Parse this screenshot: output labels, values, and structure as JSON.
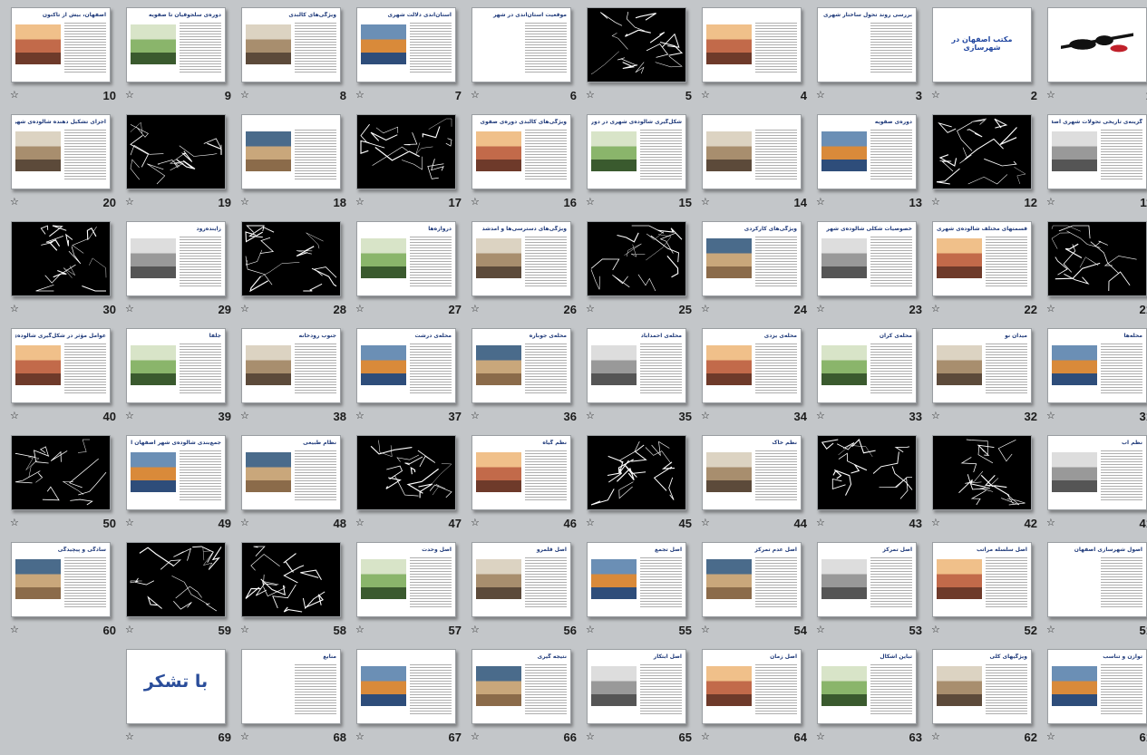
{
  "view": "slide-sorter",
  "star_glyph": "☆",
  "slides": [
    {
      "n": "1",
      "kind": "logo"
    },
    {
      "n": "2",
      "kind": "title",
      "title": "مکتب اصفهان در شهرسازی"
    },
    {
      "n": "3",
      "kind": "text",
      "title": "بررسی روند تحول ساختار شهری اصفهان"
    },
    {
      "n": "4",
      "kind": "photo",
      "title": ""
    },
    {
      "n": "5",
      "kind": "dark",
      "title": ""
    },
    {
      "n": "6",
      "kind": "text",
      "title": "موقعیت استان‌اندی در شهر"
    },
    {
      "n": "7",
      "kind": "map",
      "title": "استان‌اندی دلالت شهری"
    },
    {
      "n": "8",
      "kind": "map",
      "title": "ویژگی‌های کالبدی"
    },
    {
      "n": "9",
      "kind": "photo",
      "title": "دوره‌ی سلجوقیان تا صفویه"
    },
    {
      "n": "10",
      "kind": "map",
      "title": "اصفهان، بیش از تاکنون"
    },
    {
      "n": "11",
      "kind": "photo",
      "title": "گزینه‌ی تاریخی تحولات شهری اصفهان"
    },
    {
      "n": "12",
      "kind": "dark",
      "title": ""
    },
    {
      "n": "13",
      "kind": "photo",
      "title": "دوره‌ی صفویه"
    },
    {
      "n": "14",
      "kind": "map",
      "title": ""
    },
    {
      "n": "15",
      "kind": "photo",
      "title": "شکل‌گیری شالوده‌ی شهری در دوران صفویه"
    },
    {
      "n": "16",
      "kind": "photo",
      "title": "ویژگی‌های کالبدی دوره‌ی صفوی"
    },
    {
      "n": "17",
      "kind": "dark",
      "title": ""
    },
    {
      "n": "18",
      "kind": "photo",
      "title": ""
    },
    {
      "n": "19",
      "kind": "dark",
      "title": ""
    },
    {
      "n": "20",
      "kind": "photo",
      "title": "اجزای تشکیل دهنده شالوده‌ی شهری"
    },
    {
      "n": "21",
      "kind": "dark",
      "title": ""
    },
    {
      "n": "22",
      "kind": "photo",
      "title": "قسمتهای مختلف شالوده‌ی شهری اصفهان"
    },
    {
      "n": "23",
      "kind": "photo",
      "title": "خصوصیات شکلی شالوده‌ی شهر"
    },
    {
      "n": "24",
      "kind": "photo",
      "title": "ویژگی‌های کارکردی"
    },
    {
      "n": "25",
      "kind": "dark",
      "title": ""
    },
    {
      "n": "26",
      "kind": "photo",
      "title": "ویژگی‌های دسترسی‌ها و آمد‌شد"
    },
    {
      "n": "27",
      "kind": "photo",
      "title": "دروازه‌ها"
    },
    {
      "n": "28",
      "kind": "dark",
      "title": ""
    },
    {
      "n": "29",
      "kind": "photo",
      "title": "زاینده‌رود"
    },
    {
      "n": "30",
      "kind": "dark",
      "title": ""
    },
    {
      "n": "31",
      "kind": "photo",
      "title": "محله‌ها"
    },
    {
      "n": "32",
      "kind": "photo",
      "title": "میدان نو"
    },
    {
      "n": "33",
      "kind": "photo",
      "title": "محله‌ی کران"
    },
    {
      "n": "34",
      "kind": "photo",
      "title": "محله‌ی یزدی"
    },
    {
      "n": "35",
      "kind": "photo",
      "title": "محله‌ی احمدآباد"
    },
    {
      "n": "36",
      "kind": "photo",
      "title": "محله‌ی جوباره"
    },
    {
      "n": "37",
      "kind": "photo",
      "title": "محله‌ی درشت"
    },
    {
      "n": "38",
      "kind": "photo",
      "title": "جنوب رودخانه"
    },
    {
      "n": "39",
      "kind": "photo",
      "title": "جلفا"
    },
    {
      "n": "40",
      "kind": "photo",
      "title": "عوامل مؤثر در شکل‌گیری شالوده‌ی شهری اصفهان"
    },
    {
      "n": "41",
      "kind": "photo",
      "title": "نظم آب"
    },
    {
      "n": "42",
      "kind": "dark",
      "title": ""
    },
    {
      "n": "43",
      "kind": "dark",
      "title": ""
    },
    {
      "n": "44",
      "kind": "photo",
      "title": "نظم خاک"
    },
    {
      "n": "45",
      "kind": "dark",
      "title": ""
    },
    {
      "n": "46",
      "kind": "photo",
      "title": "نظم گیاه"
    },
    {
      "n": "47",
      "kind": "dark",
      "title": ""
    },
    {
      "n": "48",
      "kind": "photo",
      "title": "نظام طبیعی"
    },
    {
      "n": "49",
      "kind": "photo",
      "title": "جمع‌بندی شالوده‌ی شهر اصفهان از نظر عملکردی"
    },
    {
      "n": "50",
      "kind": "dark",
      "title": ""
    },
    {
      "n": "51",
      "kind": "text",
      "title": "اصول شهرسازی اصفهان"
    },
    {
      "n": "52",
      "kind": "photo",
      "title": "اصل سلسله مراتب"
    },
    {
      "n": "53",
      "kind": "photo",
      "title": "اصل تمرکز"
    },
    {
      "n": "54",
      "kind": "photo",
      "title": "اصل عدم تمرکز"
    },
    {
      "n": "55",
      "kind": "photo",
      "title": "اصل تجمع"
    },
    {
      "n": "56",
      "kind": "photo",
      "title": "اصل قلمرو"
    },
    {
      "n": "57",
      "kind": "photo",
      "title": "اصل وحدت"
    },
    {
      "n": "58",
      "kind": "dark",
      "title": ""
    },
    {
      "n": "59",
      "kind": "dark",
      "title": ""
    },
    {
      "n": "60",
      "kind": "photo",
      "title": "سادگی و پیچیدگی"
    },
    {
      "n": "61",
      "kind": "photo",
      "title": "توازن و تناسب"
    },
    {
      "n": "62",
      "kind": "photo",
      "title": "ویژگیهای کلی"
    },
    {
      "n": "63",
      "kind": "photo",
      "title": "تباین اشکال"
    },
    {
      "n": "64",
      "kind": "photo",
      "title": "اصل زمان"
    },
    {
      "n": "65",
      "kind": "photo",
      "title": "اصل ابتکار"
    },
    {
      "n": "66",
      "kind": "photo",
      "title": "نتیجه گیری"
    },
    {
      "n": "67",
      "kind": "photo",
      "title": ""
    },
    {
      "n": "68",
      "kind": "text",
      "title": "منابع"
    },
    {
      "n": "69",
      "kind": "thanks",
      "title": "با تشکر"
    }
  ],
  "colors": {
    "background": "#c3c6c9",
    "title": "#1f3a7a",
    "accent": "#2046a0"
  }
}
